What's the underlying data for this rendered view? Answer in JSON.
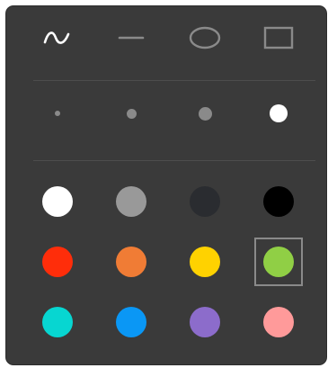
{
  "tools": [
    {
      "name": "freehand-icon",
      "active": true
    },
    {
      "name": "line-icon",
      "active": false
    },
    {
      "name": "ellipse-icon",
      "active": false
    },
    {
      "name": "rectangle-icon",
      "active": false
    }
  ],
  "sizes": [
    {
      "name": "size-extra-small",
      "active": false
    },
    {
      "name": "size-small",
      "active": false
    },
    {
      "name": "size-medium",
      "active": false
    },
    {
      "name": "size-large",
      "active": true
    }
  ],
  "colors": [
    [
      "#ffffff",
      "#999999",
      "#2a2c30",
      "#000000"
    ],
    [
      "#ff2d0a",
      "#f07c35",
      "#ffd200",
      "#90cf45"
    ],
    [
      "#07d6d1",
      "#0a97f5",
      "#8c6ccb",
      "#ff9a9a"
    ]
  ],
  "selected_color": "#90cf45",
  "theme": {
    "panel_bg": "#3a3a3a",
    "icon_active": "#ffffff",
    "icon_inactive": "#8a8a8a"
  }
}
